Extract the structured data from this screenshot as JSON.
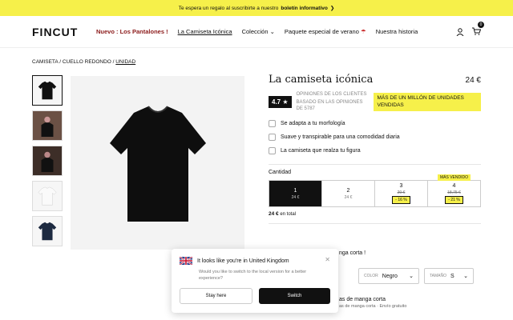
{
  "promo": {
    "text": "Te espera un regalo al suscribirte a nuestro",
    "link": "boletín informativo",
    "arrow": "❯"
  },
  "header": {
    "logo": "FINCUT",
    "menu": [
      "Nuevo : Los Pantalones !",
      "La Camiseta Icónica",
      "Colección",
      "Paquete especial de verano",
      "Nuestra historia"
    ],
    "cart_count": "0"
  },
  "breadcrumb": {
    "a": "CAMISETA",
    "sep1": " / ",
    "b": "CUELLO REDONDO",
    "sep2": " / ",
    "c": "UNIDAD"
  },
  "product": {
    "title": "La camiseta icónica",
    "price": "24 €",
    "rating": "4.7 ★",
    "rating_label": "OPINIONES DE LOS CLIENTES",
    "rating_sub": "BASADO EN LAS OPINIONES DE 5787",
    "badge": "MÁS DE UN MILLÓN DE UNIDADES VENDIDAS",
    "features": [
      "Se adapta a tu morfología",
      "Suave y transpirable para una comodidad diaria",
      "La camiseta que realza tu figura"
    ]
  },
  "quantity": {
    "label": "Cantidad",
    "options": [
      {
        "n": "1",
        "price": "24 €"
      },
      {
        "n": "2",
        "price": "24 €"
      },
      {
        "n": "3",
        "price": "20 €",
        "disc": "- 16 %"
      },
      {
        "n": "4",
        "price": "18,75 €",
        "disc": "- 21 %",
        "tag": "MÁS VENDIDO"
      }
    ],
    "total_price": "24 €",
    "total_label": "en total"
  },
  "behind": {
    "line1": "nga corta !",
    "color_label": "COLOR",
    "color_value": "Negro",
    "size_label": "TAMAÑO",
    "size_value": "S",
    "line2": "as de manga corta",
    "line3": "as de manga corta · Envío gratuito"
  },
  "popup": {
    "title": "It looks like you're in United Kingdom",
    "body": "Would you like to switch to the local version for a better experience?",
    "stay": "Stay here",
    "switch": "Switch"
  }
}
